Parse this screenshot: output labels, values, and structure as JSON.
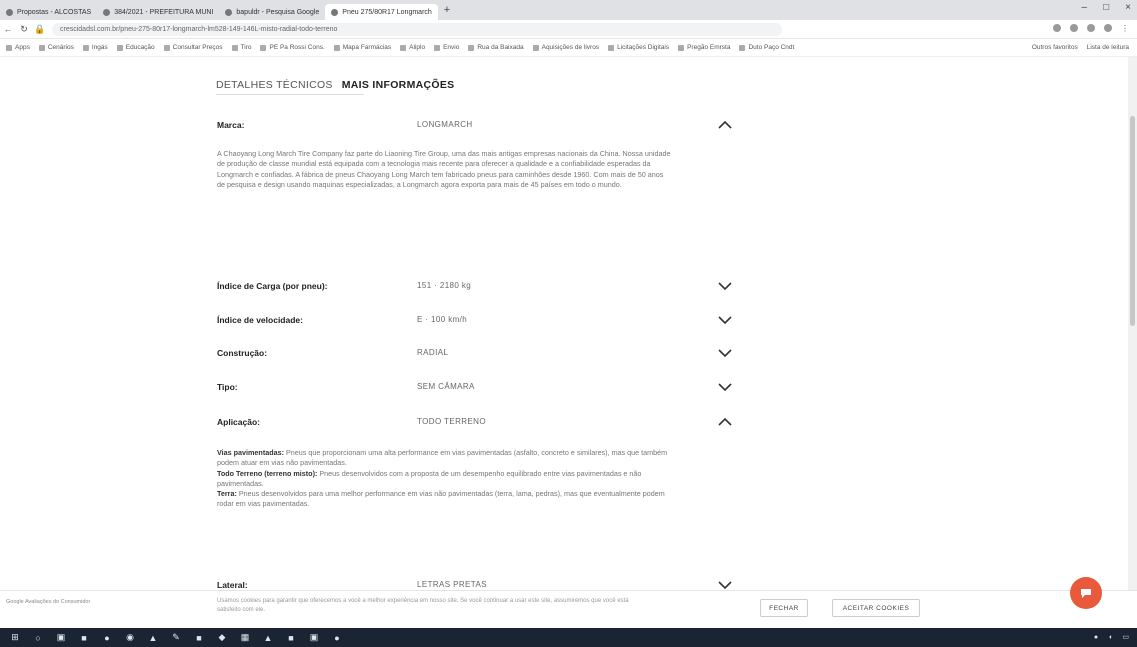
{
  "browser": {
    "tabs": [
      {
        "label": "Propostas - ALCOSTAS",
        "active": false
      },
      {
        "label": "384/2021 - PREFEITURA MUNI",
        "active": false
      },
      {
        "label": "bapuldr - Pesquisa Google",
        "active": false
      },
      {
        "label": "Pneu 275/80R17 Longmarch",
        "active": true
      }
    ],
    "url": "crescidadsl.com.br/pneu-275-80r17-longmarch-lm528-149-146L-misto-radial-todo-terreno",
    "bookmarks": [
      "Apps",
      "Cenários",
      "Ingás",
      "Educação",
      "Consultar Preços",
      "Tiro",
      "PE Pa Rossi Cons.",
      "Mapa Farmácias",
      "Aliplo",
      "Envio",
      "Rua da Baixada",
      "Aquisições de livros",
      "Licitações Digitais",
      "Pregão Emrsta",
      "Duto Paço Cndt"
    ],
    "other_bookmarks": "Outros favoritos",
    "reading_list": "Lista de leitura"
  },
  "page": {
    "tab_technical": "DETALHES TÉCNICOS",
    "tab_more": "MAIS INFORMAÇÕES",
    "rows": [
      {
        "label": "Marca:",
        "value": "LONGMARCH",
        "expanded": true
      },
      {
        "label": "Índice de Carga (por pneu):",
        "value": "151 · 2180 kg",
        "expanded": false
      },
      {
        "label": "Índice de velocidade:",
        "value": "E · 100 km/h",
        "expanded": false
      },
      {
        "label": "Construção:",
        "value": "RADIAL",
        "expanded": false
      },
      {
        "label": "Tipo:",
        "value": "SEM CÂMARA",
        "expanded": false
      },
      {
        "label": "Aplicação:",
        "value": "TODO TERRENO",
        "expanded": true
      },
      {
        "label": "Lateral:",
        "value": "LETRAS PRETAS",
        "expanded": false
      }
    ],
    "brand_text": "A Chaoyang Long March Tire Company faz parte do Liaoning Tire Group, uma das mais antigas empresas nacionais da China. Nossa unidade de produção de classe mundial está equipada com a tecnologia mais recente para oferecer a qualidade e a confiabilidade esperadas da Longmarch e confiadas. A fábrica de pneus Chaoyang Long March tem fabricado pneus para caminhões desde 1960. Com mais de 50 anos de pesquisa e design usando maquinas especializadas, a Longmarch agora exporta para mais de 45 países em todo o mundo.",
    "application": [
      {
        "term": "Vias pavimentadas:",
        "text": "Pneus que proporcionam uma alta performance em vias pavimentadas (asfalto, concreto e similares), mas que também podem atuar em vias não pavimentadas."
      },
      {
        "term": "Todo Terreno (terreno misto):",
        "text": "Pneus desenvolvidos com a proposta de um desempenho equilibrado entre vias pavimentadas e não pavimentadas."
      },
      {
        "term": "Terra:",
        "text": "Pneus desenvolvidos para uma melhor performance em vias não pavimentadas (terra, lama, pedras), mas que eventualmente podem rodar em vias pavimentadas."
      }
    ]
  },
  "cookie": {
    "message": "Usamos cookies para garantir que oferecemos a você a melhor experiência em nosso site. Se você continuar a usar este site, assumiremos que você está satisfeito com ele.",
    "close_label": "FECHAR",
    "accept_label": "ACEITAR COOKIES",
    "badge_label": "Google Avaliações do Consumidor"
  }
}
